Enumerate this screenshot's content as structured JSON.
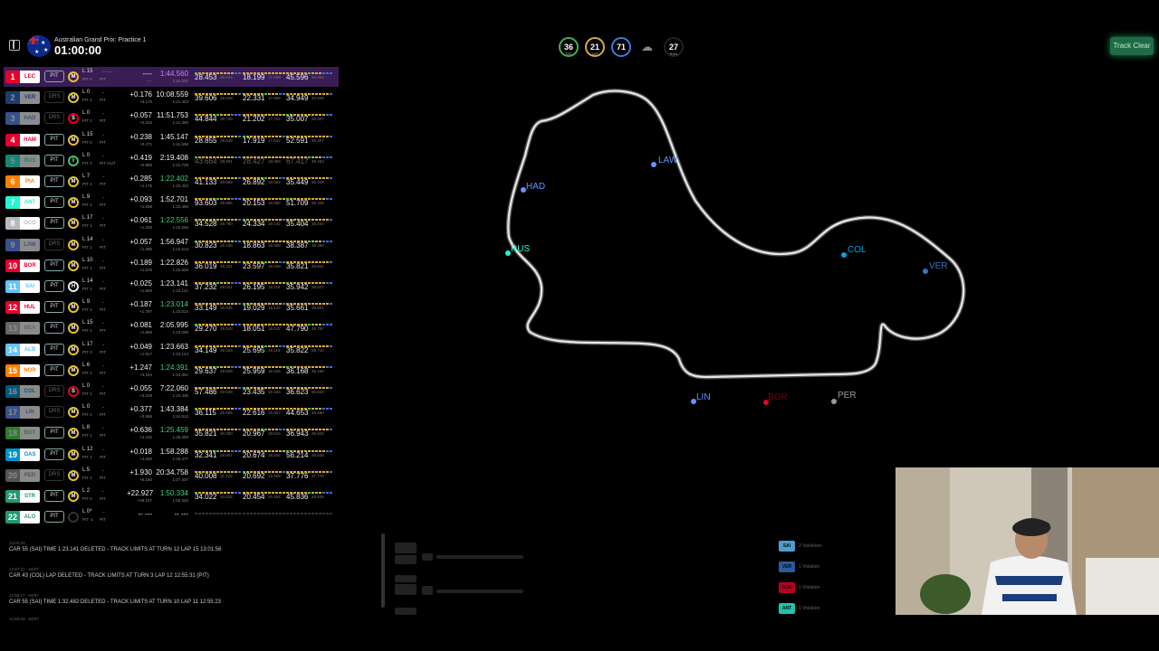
{
  "header": {
    "event": "Australian Grand Prix: Practice 1",
    "clock": "01:00:00",
    "gauges": [
      {
        "value": "36",
        "unit": "TRC",
        "color": "#3fae5b"
      },
      {
        "value": "21",
        "unit": "AIR",
        "color": "#d9a93a"
      },
      {
        "value": "71",
        "unit": "",
        "color": "#3b7bd9"
      },
      {
        "value": "27",
        "unit": "RUN",
        "color": "#222222"
      }
    ],
    "track_status": "Track Clear"
  },
  "drivers": [
    {
      "pos": "1",
      "code": "LEC",
      "color": "#e8002d",
      "pit": "PIT",
      "tyre": "M",
      "lap": "L 15",
      "pitn": "PIT 0",
      "pitst": "PIT",
      "dash": "-- ---",
      "gap": "----",
      "int": "----",
      "best": "1:44.560",
      "best_cls": "ov",
      "last": "1:22.237",
      "s1": "28.453",
      "s1sub": "28.344",
      "s1cls": "",
      "s2": "18.199",
      "s2sub": "17.638",
      "s2cls": "",
      "s3": "45.596",
      "s3sub": "35.063",
      "s3cls": "",
      "hl": true,
      "dim": false
    },
    {
      "pos": "2",
      "code": "VER",
      "color": "#3671c6",
      "pit": "DRS",
      "tyre": "M",
      "lap": "L 0",
      "pitn": "PIT 2",
      "pitst": "PIT",
      "dash": "-",
      "gap": "+0.176",
      "int": "+0.176",
      "best": "10:08.559",
      "best_cls": "",
      "last": "1:21.403",
      "s1": "39.606",
      "s1sub": "28.648",
      "s1cls": "",
      "s2": "22.331",
      "s2sub": "17.806",
      "s2cls": "",
      "s3": "34.949",
      "s3sub": "34.949",
      "s3cls": "",
      "hl": false,
      "dim": true
    },
    {
      "pos": "3",
      "code": "HAD",
      "color": "#6692ff",
      "pit": "DRS",
      "tyre": "S",
      "lap": "L 0",
      "pitn": "PIT 2",
      "pitst": "PIT",
      "dash": "-",
      "gap": "+0.057",
      "int": "+0.233",
      "best": "11:51.753",
      "best_cls": "",
      "last": "1:21.460",
      "s1": "44.844",
      "s1sub": "28.729",
      "s1cls": "",
      "s2": "21.202",
      "s2sub": "17.724",
      "s2cls": "",
      "s3": "35.007",
      "s3sub": "35.007",
      "s3cls": "",
      "hl": false,
      "dim": true
    },
    {
      "pos": "4",
      "code": "HAM",
      "color": "#e8002d",
      "pit": "PIT",
      "tyre": "M",
      "lap": "L 15",
      "pitn": "PIT 0",
      "pitst": "PIT",
      "dash": "-",
      "gap": "+0.238",
      "int": "+0.471",
      "best": "1:45.147",
      "best_cls": "",
      "last": "1:21.598",
      "s1": "28.855",
      "s1sub": "28.648",
      "s1cls": "",
      "s2": "17.919",
      "s2sub": "17.642",
      "s2cls": "",
      "s3": "52.591",
      "s3sub": "35.307",
      "s3cls": "",
      "hl": false,
      "dim": false
    },
    {
      "pos": "5",
      "code": "RUS",
      "color": "#27f4d2",
      "pit": "PIT",
      "tyre": "I",
      "lap": "L 0",
      "pitn": "PIT 3",
      "pitst": "PIT OUT",
      "dash": "-",
      "gap": "+0.419",
      "int": "+0.890",
      "best": "2:19.408",
      "best_cls": "",
      "last": "1:21.729",
      "s1": "43.664",
      "s1sub": "28.591",
      "s1cls": "dim",
      "s2": "28.427",
      "s2sub": "18.063",
      "s2cls": "dim",
      "s3": "67.417",
      "s3sub": "35.463",
      "s3cls": "dim",
      "hl": false,
      "dim": true
    },
    {
      "pos": "6",
      "code": "PIA",
      "color": "#ff8000",
      "pit": "PIT",
      "tyre": "M",
      "lap": "L 7",
      "pitn": "PIT 1",
      "pitst": "PIT",
      "dash": "-",
      "gap": "+0.285",
      "int": "+1.175",
      "best": "1:22.402",
      "best_cls": "pb",
      "last": "1:22.402",
      "s1": "41.133",
      "s1sub": "28.869",
      "s1cls": "",
      "s2": "26.892",
      "s2sub": "18.064",
      "s2cls": "",
      "s3": "35.449",
      "s3sub": "35.449",
      "s3cls": "",
      "hl": false,
      "dim": false
    },
    {
      "pos": "7",
      "code": "ANT",
      "color": "#27f4d2",
      "pit": "PIT",
      "tyre": "M",
      "lap": "L 9",
      "pitn": "PIT 2",
      "pitst": "PIT",
      "dash": "-",
      "gap": "+0.093",
      "int": "+1.268",
      "best": "1:52.701",
      "best_cls": "",
      "last": "1:22.495",
      "s1": "93.603",
      "s1sub": "28.996",
      "s1cls": "",
      "s2": "20.153",
      "s2sub": "18.059",
      "s2cls": "",
      "s3": "51.709",
      "s3sub": "35.345",
      "s3cls": "",
      "hl": false,
      "dim": false
    },
    {
      "pos": "8",
      "code": "OCO",
      "color": "#b6babd",
      "pit": "PIT",
      "tyre": "M",
      "lap": "L 17",
      "pitn": "PIT 1",
      "pitst": "PIT",
      "dash": "-",
      "gap": "+0.061",
      "int": "+1.329",
      "best": "1:22.556",
      "best_cls": "pb",
      "last": "1:22.556",
      "s1": "34.528",
      "s1sub": "28.780",
      "s1cls": "",
      "s2": "24.334",
      "s2sub": "18.142",
      "s2cls": "",
      "s3": "35.404",
      "s3sub": "35.404",
      "s3cls": "",
      "hl": false,
      "dim": false
    },
    {
      "pos": "9",
      "code": "LAW",
      "color": "#6692ff",
      "pit": "DRS",
      "tyre": "M",
      "lap": "L 14",
      "pitn": "PIT 1",
      "pitst": "PIT",
      "dash": "-",
      "gap": "+0.057",
      "int": "+1.386",
      "best": "1:56.947",
      "best_cls": "",
      "last": "1:22.613",
      "s1": "30.823",
      "s1sub": "29.136",
      "s1cls": "",
      "s2": "18.863",
      "s2sub": "18.008",
      "s2cls": "",
      "s3": "38.387",
      "s3sub": "35.469",
      "s3cls": "",
      "hl": false,
      "dim": true
    },
    {
      "pos": "10",
      "code": "BOR",
      "color": "#e8002d",
      "pit": "PIT",
      "tyre": "M",
      "lap": "L 10",
      "pitn": "PIT 1",
      "pitst": "PIT",
      "dash": "-",
      "gap": "+0.189",
      "int": "+1.575",
      "best": "1:22.826",
      "best_cls": "",
      "last": "1:22.826",
      "s1": "36.019",
      "s1sub": "28.321",
      "s1cls": "",
      "s2": "23.597",
      "s2sub": "18.039",
      "s2cls": "",
      "s3": "35.821",
      "s3sub": "35.821",
      "s3cls": "",
      "hl": false,
      "dim": false
    },
    {
      "pos": "11",
      "code": "SAI",
      "color": "#64c4ff",
      "pit": "PIT",
      "tyre": "H",
      "lap": "L 14",
      "pitn": "PIT 1",
      "pitst": "PIT",
      "dash": "-",
      "gap": "+0.025",
      "int": "+1.600",
      "best": "1:23.141",
      "best_cls": "",
      "last": "1:23.141",
      "s1": "37.232",
      "s1sub": "29.021",
      "s1cls": "",
      "s2": "26.195",
      "s2sub": "18.118",
      "s2cls": "",
      "s3": "35.942",
      "s3sub": "35.627",
      "s3cls": "",
      "hl": false,
      "dim": false
    },
    {
      "pos": "12",
      "code": "HUL",
      "color": "#e8002d",
      "pit": "PIT",
      "tyre": "M",
      "lap": "L 9",
      "pitn": "PIT 1",
      "pitst": "PIT",
      "dash": "-",
      "gap": "+0.187",
      "int": "+1.787",
      "best": "1:23.014",
      "best_cls": "pb",
      "last": "1:23.014",
      "s1": "33.149",
      "s1sub": "28.845",
      "s1cls": "",
      "s2": "19.029",
      "s2sub": "18.134",
      "s2cls": "",
      "s3": "35.661",
      "s3sub": "35.661",
      "s3cls": "",
      "hl": false,
      "dim": false
    },
    {
      "pos": "13",
      "code": "BEA",
      "color": "#b6babd",
      "pit": "PIT",
      "tyre": "M",
      "lap": "L 15",
      "pitn": "PIT 1",
      "pitst": "PIT",
      "dash": "-",
      "gap": "+0.081",
      "int": "+1.868",
      "best": "2:05.995",
      "best_cls": "",
      "last": "1:23.095",
      "s1": "29.270",
      "s1sub": "29.043",
      "s1cls": "",
      "s2": "18.051",
      "s2sub": "18.042",
      "s2cls": "",
      "s3": "47.790",
      "s3sub": "35.797",
      "s3cls": "",
      "hl": false,
      "dim": true
    },
    {
      "pos": "14",
      "code": "ALB",
      "color": "#64c4ff",
      "pit": "PIT",
      "tyre": "M",
      "lap": "L 17",
      "pitn": "PIT 0",
      "pitst": "PIT",
      "dash": "-",
      "gap": "+0.049",
      "int": "+1.917",
      "best": "1:23.663",
      "best_cls": "",
      "last": "1:23.144",
      "s1": "34.149",
      "s1sub": "29.126",
      "s1cls": "",
      "s2": "25.695",
      "s2sub": "18.115",
      "s2cls": "",
      "s3": "35.822",
      "s3sub": "35.710",
      "s3cls": "",
      "hl": false,
      "dim": false
    },
    {
      "pos": "15",
      "code": "NOR",
      "color": "#ff8000",
      "pit": "PIT",
      "tyre": "M",
      "lap": "L 6",
      "pitn": "PIT 1",
      "pitst": "PIT",
      "dash": "-",
      "gap": "+1.247",
      "int": "+3.164",
      "best": "1:24.391",
      "best_cls": "pb",
      "last": "1:24.391",
      "s1": "29.637",
      "s1sub": "29.509",
      "s1cls": "",
      "s2": "25.959",
      "s2sub": "18.325",
      "s2cls": "",
      "s3": "36.168",
      "s3sub": "36.168",
      "s3cls": "",
      "hl": false,
      "dim": false
    },
    {
      "pos": "16",
      "code": "COL",
      "color": "#00a1e8",
      "pit": "DRS",
      "tyre": "S",
      "lap": "L 0",
      "pitn": "PIT 2",
      "pitst": "PIT",
      "dash": "-",
      "gap": "+0.055",
      "int": "+3.219",
      "best": "7:22.060",
      "best_cls": "",
      "last": "1:24.436",
      "s1": "57.486",
      "s1sub": "29.639",
      "s1cls": "",
      "s2": "23.435",
      "s2sub": "18.184",
      "s2cls": "",
      "s3": "36.623",
      "s3sub": "36.623",
      "s3cls": "",
      "hl": false,
      "dim": true
    },
    {
      "pos": "17",
      "code": "LIN",
      "color": "#6692ff",
      "pit": "DRS",
      "tyre": "M",
      "lap": "L 0",
      "pitn": "PIT 2",
      "pitst": "PIT",
      "dash": "-",
      "gap": "+0.377",
      "int": "+3.596",
      "best": "1:43.384",
      "best_cls": "",
      "last": "1:24.813",
      "s1": "36.115",
      "s1sub": "29.806",
      "s1cls": "",
      "s2": "22.616",
      "s2sub": "18.357",
      "s2cls": "",
      "s3": "44.653",
      "s3sub": "36.690",
      "s3cls": "",
      "hl": false,
      "dim": true
    },
    {
      "pos": "18",
      "code": "BOT",
      "color": "#52e252",
      "pit": "PIT",
      "tyre": "M",
      "lap": "L 8",
      "pitn": "PIT 1",
      "pitst": "PIT",
      "dash": "-",
      "gap": "+0.636",
      "int": "+4.232",
      "best": "1:25.459",
      "best_cls": "pb",
      "last": "1:25.459",
      "s1": "35.821",
      "s1sub": "30.000",
      "s1cls": "",
      "s2": "20.967",
      "s2sub": "18.516",
      "s2cls": "",
      "s3": "36.943",
      "s3sub": "36.943",
      "s3cls": "",
      "hl": false,
      "dim": true
    },
    {
      "pos": "19",
      "code": "GAS",
      "color": "#0093cc",
      "pit": "PIT",
      "tyre": "M",
      "lap": "L 12",
      "pitn": "PIT 1",
      "pitst": "PIT",
      "dash": "-",
      "gap": "+0.018",
      "int": "+4.250",
      "best": "1:58.288",
      "best_cls": "",
      "last": "1:25.477",
      "s1": "32.341",
      "s1sub": "29.857",
      "s1cls": "",
      "s2": "20.674",
      "s2sub": "18.405",
      "s2cls": "",
      "s3": "56.214",
      "s3sub": "36.638",
      "s3cls": "",
      "hl": false,
      "dim": false
    },
    {
      "pos": "20",
      "code": "PER",
      "color": "#9a9a9a",
      "pit": "DRS",
      "tyre": "M",
      "lap": "L 5",
      "pitn": "PIT 1",
      "pitst": "PIT",
      "dash": "-",
      "gap": "+1.930",
      "int": "+6.180",
      "best": "20:34.758",
      "best_cls": "",
      "last": "1:27.407",
      "s1": "40.008",
      "s1sub": "31.222",
      "s1cls": "",
      "s2": "20.692",
      "s2sub": "18.405",
      "s2cls": "",
      "s3": "37.776",
      "s3sub": "37.776",
      "s3cls": "",
      "hl": false,
      "dim": true
    },
    {
      "pos": "21",
      "code": "STR",
      "color": "#229971",
      "pit": "PIT",
      "tyre": "M",
      "lap": "L 2",
      "pitn": "PIT 0",
      "pitst": "PIT",
      "dash": "-",
      "gap": "+22.927",
      "int": "+29.107",
      "best": "1:50.334",
      "best_cls": "pb",
      "last": "1:50.334",
      "s1": "34.022",
      "s1sub": "34.022",
      "s1cls": "",
      "s2": "20.454",
      "s2sub": "20.454",
      "s2cls": "",
      "s3": "45.836",
      "s3sub": "45.836",
      "s3cls": "",
      "hl": false,
      "dim": false
    },
    {
      "pos": "22",
      "code": "ALO",
      "color": "#229971",
      "pit": "PIT",
      "tyre": "",
      "lap": "L 0*",
      "pitn": "PIT -1",
      "pitst": "PIT",
      "dash": "-",
      "gap": "-- ---",
      "int": "",
      "best": "-- ---",
      "best_cls": "",
      "last": "",
      "s1": "",
      "s1sub": "",
      "s1cls": "",
      "s2": "",
      "s2sub": "",
      "s2cls": "",
      "s3": "",
      "s3sub": "",
      "s3cls": "",
      "hl": false,
      "dim": false
    }
  ],
  "map_labels": {
    "LAW": {
      "text": "LAW",
      "color": "#6692ff"
    },
    "HAD": {
      "text": "HAD",
      "color": "#6692ff"
    },
    "RUS": {
      "text": "RUS",
      "color": "#27f4d2"
    },
    "COL": {
      "text": "COL",
      "color": "#00a1e8"
    },
    "VER": {
      "text": "VER",
      "color": "#3671c6"
    },
    "LIN": {
      "text": "LIN",
      "color": "#6692ff"
    },
    "PER": {
      "text": "PER",
      "color": "#9a9a9a"
    },
    "BOR": {
      "text": "BOR",
      "color": "#e8002d"
    }
  },
  "race_control": [
    {
      "time": "13:02:23",
      "msg": "CAR 55 (SAI) TIME 1:23.141 DELETED - TRACK LIMITS AT TURN 12 LAP 15 13:01:56"
    },
    {
      "time": "12:57:21 · 04/07",
      "msg": "CAR 43 (COL) LAP DELETED - TRACK LIMITS AT TURN 3 LAP 12 12:55:31 (PIT)"
    },
    {
      "time": "12:56:17 · 04/07",
      "msg": "CAR 55 (SAI) TIME 1:32.482 DELETED - TRACK LIMITS AT TURN 10 LAP 11 12:55:23"
    },
    {
      "time": "12:56:03 · 04/07",
      "msg": ""
    }
  ],
  "violations": [
    {
      "code": "SAI",
      "color": "#64c4ff",
      "text": "2 Violations"
    },
    {
      "code": "VER",
      "color": "#3671c6",
      "text": "1 Violation"
    },
    {
      "code": "BOR",
      "color": "#e8002d",
      "text": "1 Violation"
    },
    {
      "code": "ANT",
      "color": "#27f4d2",
      "text": "1 Violation"
    }
  ]
}
